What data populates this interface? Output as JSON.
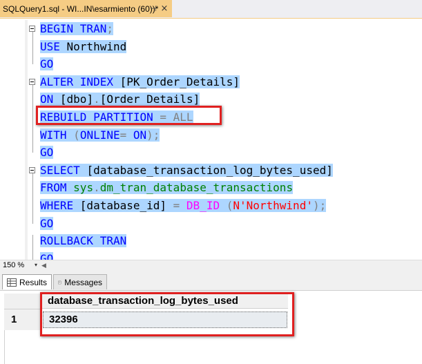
{
  "tab": {
    "title": "SQLQuery1.sql - WI...IN\\esarmiento (60))*",
    "pin": "⊣",
    "close": "×"
  },
  "editor": {
    "lines": [
      {
        "parts": [
          {
            "t": "BEGIN TRAN",
            "c": "kw"
          },
          {
            "t": ";",
            "c": "gray"
          }
        ]
      },
      {
        "parts": [
          {
            "t": "USE ",
            "c": "kw"
          },
          {
            "t": "Northwind",
            "c": "txt"
          }
        ]
      },
      {
        "parts": [
          {
            "t": "GO",
            "c": "kw"
          }
        ]
      },
      {
        "parts": [
          {
            "t": "ALTER INDEX ",
            "c": "kw"
          },
          {
            "t": "[PK_Order_Details]",
            "c": "txt"
          }
        ]
      },
      {
        "parts": [
          {
            "t": "ON ",
            "c": "kw"
          },
          {
            "t": "[dbo]",
            "c": "txt"
          },
          {
            "t": ".",
            "c": "gray"
          },
          {
            "t": "[Order Details]",
            "c": "txt"
          }
        ]
      },
      {
        "parts": [
          {
            "t": "REBUILD PARTITION ",
            "c": "kw"
          },
          {
            "t": "= ALL",
            "c": "gray"
          }
        ]
      },
      {
        "parts": [
          {
            "t": "WITH ",
            "c": "kw"
          },
          {
            "t": "(",
            "c": "gray"
          },
          {
            "t": "ONLINE",
            "c": "kw"
          },
          {
            "t": "= ",
            "c": "gray"
          },
          {
            "t": "ON",
            "c": "kw"
          },
          {
            "t": ");",
            "c": "gray"
          }
        ]
      },
      {
        "parts": [
          {
            "t": "GO",
            "c": "kw"
          }
        ]
      },
      {
        "parts": [
          {
            "t": "SELECT ",
            "c": "kw"
          },
          {
            "t": "[database_transaction_log_bytes_used]",
            "c": "txt"
          }
        ]
      },
      {
        "parts": [
          {
            "t": "FROM ",
            "c": "kw"
          },
          {
            "t": "sys",
            "c": "sys"
          },
          {
            "t": ".",
            "c": "gray"
          },
          {
            "t": "dm_tran_database_transactions",
            "c": "sys"
          }
        ]
      },
      {
        "parts": [
          {
            "t": "WHERE ",
            "c": "kw"
          },
          {
            "t": "[database_id] ",
            "c": "txt"
          },
          {
            "t": "= ",
            "c": "gray"
          },
          {
            "t": "DB_ID ",
            "c": "fn"
          },
          {
            "t": "(",
            "c": "gray"
          },
          {
            "t": "N'Northwind'",
            "c": "str"
          },
          {
            "t": ");",
            "c": "gray"
          }
        ]
      },
      {
        "parts": [
          {
            "t": "GO",
            "c": "kw"
          }
        ]
      },
      {
        "parts": [
          {
            "t": "ROLLBACK TRAN",
            "c": "kw"
          }
        ]
      },
      {
        "parts": [
          {
            "t": "GO",
            "c": "kw"
          }
        ]
      }
    ]
  },
  "zoom": {
    "value": "150 %",
    "dropdown": "▾"
  },
  "results_tabs": {
    "results": "Results",
    "messages": "Messages"
  },
  "grid": {
    "columns": [
      "database_transaction_log_bytes_used"
    ],
    "rows": [
      {
        "num": "1",
        "values": [
          "32396"
        ]
      }
    ]
  },
  "colors": {
    "selection": "#add6ff",
    "keyword": "#0000ff",
    "highlight": "#e02020",
    "tab_active": "#f5cc84"
  }
}
